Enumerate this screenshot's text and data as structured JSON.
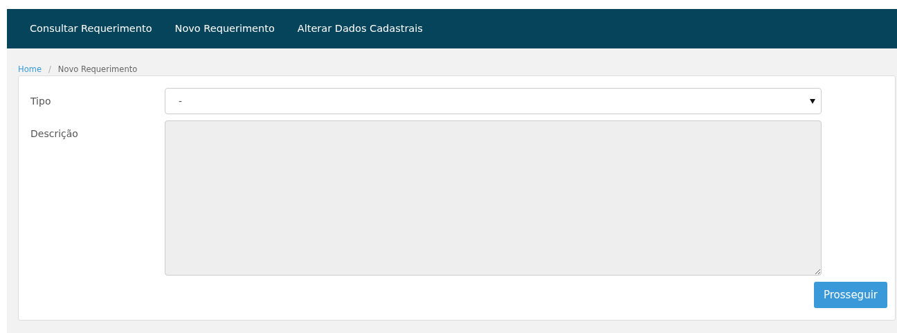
{
  "navbar": {
    "items": [
      "Consultar Requerimento",
      "Novo Requerimento",
      "Alterar Dados Cadastrais"
    ]
  },
  "breadcrumb": {
    "links": [
      "Home"
    ],
    "separator": "/",
    "current": "Novo Requerimento"
  },
  "form": {
    "tipo": {
      "label": "Tipo",
      "value": "-"
    },
    "descricao": {
      "label": "Descrição",
      "disabled": true
    },
    "submit": "Prosseguir"
  }
}
